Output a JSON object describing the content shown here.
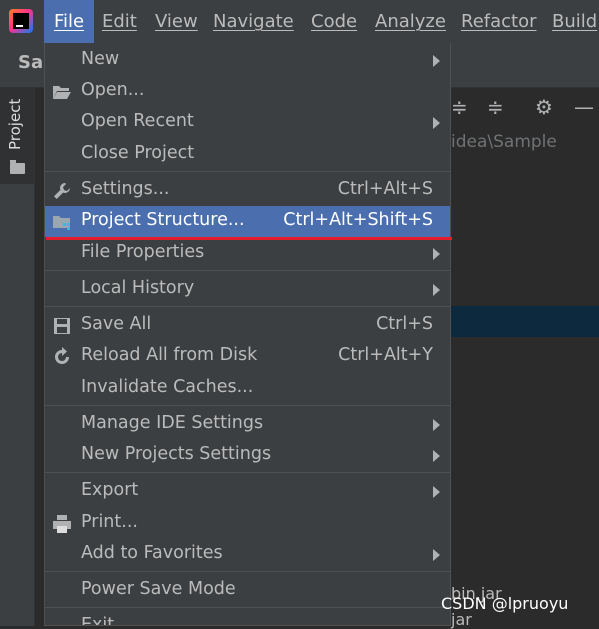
{
  "menubar": {
    "items": [
      "File",
      "Edit",
      "View",
      "Navigate",
      "Code",
      "Analyze",
      "Refactor",
      "Build"
    ]
  },
  "toolbar": {
    "project_name": "Sa"
  },
  "side_panel": {
    "label": "Project"
  },
  "background": {
    "path": "idea\\Sample",
    "jar1": "bin.jar",
    "jar2": "jar"
  },
  "watermark": "CSDN @lpruoyu",
  "file_menu": {
    "new": "New",
    "open": "Open...",
    "open_recent": "Open Recent",
    "close_project": "Close Project",
    "settings": "Settings...",
    "settings_shortcut": "Ctrl+Alt+S",
    "project_structure": "Project Structure...",
    "project_structure_shortcut": "Ctrl+Alt+Shift+S",
    "file_properties": "File Properties",
    "local_history": "Local History",
    "save_all": "Save All",
    "save_all_shortcut": "Ctrl+S",
    "reload": "Reload All from Disk",
    "reload_shortcut": "Ctrl+Alt+Y",
    "invalidate": "Invalidate Caches...",
    "manage_ide": "Manage IDE Settings",
    "new_projects": "New Projects Settings",
    "export": "Export",
    "print": "Print...",
    "add_favorites": "Add to Favorites",
    "power_save": "Power Save Mode",
    "exit": "Exit"
  },
  "colors": {
    "selection": "#4b6eaf",
    "highlight_underline": "#e41d2a",
    "menu_bg": "#3c3f41"
  }
}
